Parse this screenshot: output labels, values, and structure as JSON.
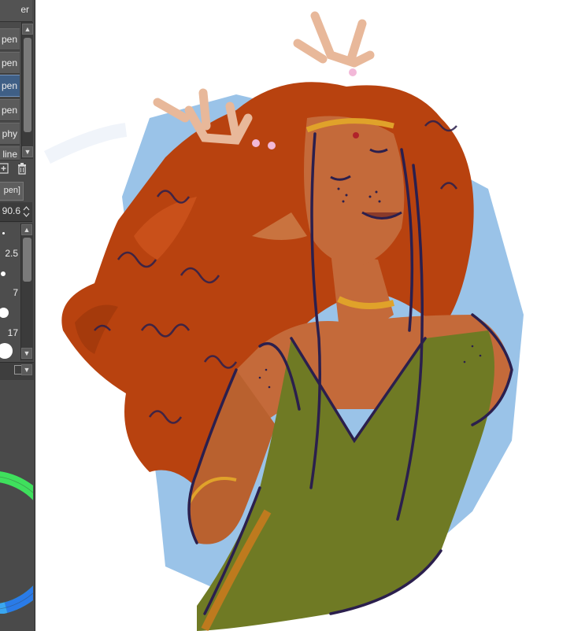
{
  "panel": {
    "header_label": "er"
  },
  "subtools": {
    "items": [
      {
        "label": "pen"
      },
      {
        "label": "pen"
      },
      {
        "label": "pen"
      },
      {
        "label": ""
      },
      {
        "label": "pen"
      },
      {
        "label": "phy"
      },
      {
        "label": "line"
      }
    ],
    "selected_index": 2
  },
  "tool_property": {
    "tab_label": "pen]",
    "brush_size_value": "90.6",
    "presets": [
      {
        "label": ""
      },
      {
        "label": "2.5"
      },
      {
        "label": ""
      },
      {
        "label": "7"
      },
      {
        "label": ""
      },
      {
        "label": "17"
      },
      {
        "label": ""
      }
    ]
  },
  "icons": {
    "new_subtool": "add-icon",
    "delete_subtool": "trash-icon",
    "spinner": "updown-arrows-icon",
    "scroll_up": "chevron-up-icon",
    "scroll_down": "chevron-down-icon",
    "dropdown": "chevron-down-icon"
  },
  "colors": {
    "panel_bg": "#4a4a4a",
    "selected_item": "#3f5f86",
    "canvas_bg": "#ffffff",
    "hair": "#b8420f",
    "skin": "#c46a3a",
    "dress": "#6f7a24",
    "lineart": "#2b1f4d",
    "gold": "#e0a22a",
    "backdrop_blue": "#8fbde6"
  }
}
